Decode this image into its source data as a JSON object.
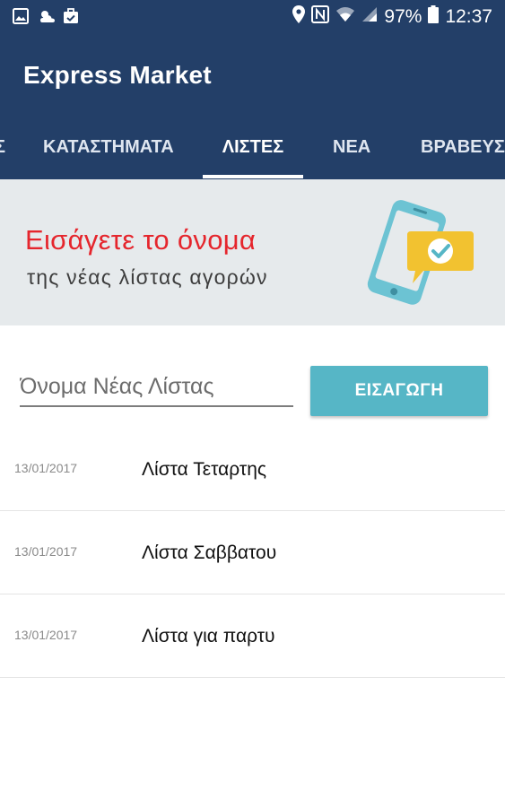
{
  "status_bar": {
    "left_icons": [
      "image-icon",
      "weather-icon",
      "briefcase-icon"
    ],
    "right_icons": [
      "location-icon",
      "nfc-icon",
      "wifi-icon",
      "signal-icon",
      "battery-icon"
    ],
    "battery": "97%",
    "time": "12:37"
  },
  "app": {
    "title": "Express Market"
  },
  "tabs": [
    {
      "label": "Σ",
      "active": false
    },
    {
      "label": "ΚΑΤΑΣΤΗΜΑΤΑ",
      "active": false
    },
    {
      "label": "ΛΙΣΤΕΣ",
      "active": true
    },
    {
      "label": "ΝΕΑ",
      "active": false
    },
    {
      "label": "ΒΡΑΒΕΥΣ",
      "active": false
    }
  ],
  "banner": {
    "headline": "Εισάγετε το όνομα",
    "subline": "της νέας λίστας αγορών",
    "headline_color": "#e5262d"
  },
  "new_list": {
    "placeholder": "Όνομα Νέας Λίστας",
    "button_label": "ΕΙΣΑΓΩΓΗ"
  },
  "lists": [
    {
      "date": "13/01/2017",
      "name": "Λίστα Τεταρτης"
    },
    {
      "date": "13/01/2017",
      "name": "Λίστα Σαββατου"
    },
    {
      "date": "13/01/2017",
      "name": "Λίστα για παρτυ"
    }
  ],
  "colors": {
    "primary": "#233f68",
    "accent": "#56b6c6",
    "banner_bg": "#e6eaec"
  }
}
